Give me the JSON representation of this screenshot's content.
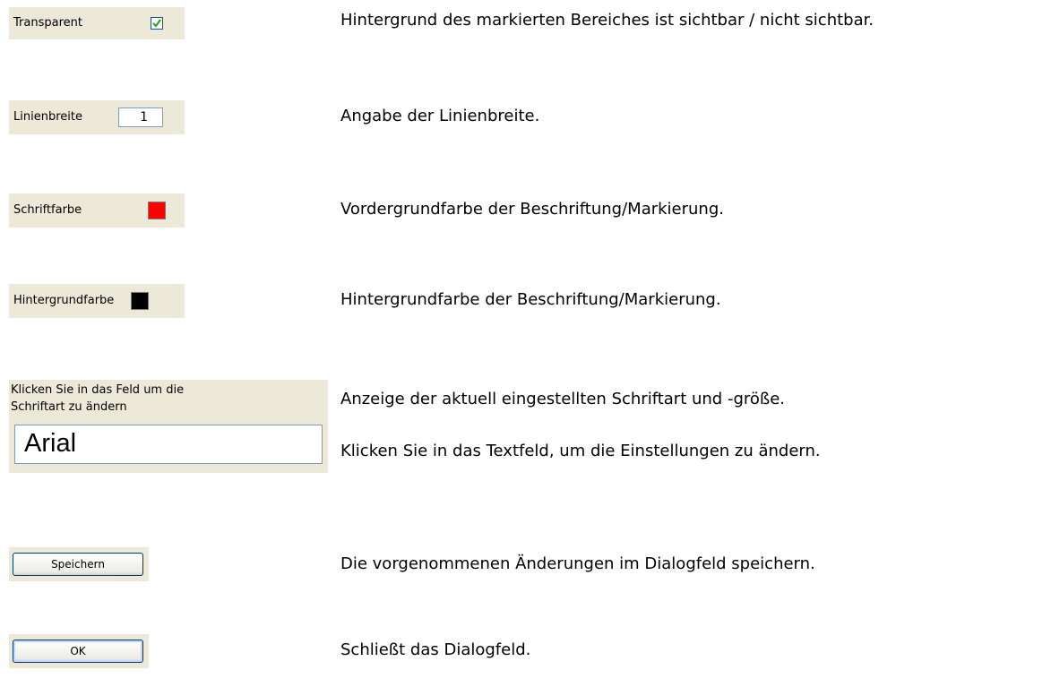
{
  "rows": [
    {
      "label": "Transparent",
      "checked": true,
      "description": "Hintergrund des markierten Bereiches ist sichtbar / nicht sichtbar."
    },
    {
      "label": "Linienbreite",
      "value": "1",
      "description": "Angabe der Linienbreite."
    },
    {
      "label": "Schriftfarbe",
      "color": "#ff0000",
      "description": "Vordergrundfarbe der Beschriftung/Markierung."
    },
    {
      "label": "Hintergrundfarbe",
      "color": "#000000",
      "description": "Hintergrundfarbe der Beschriftung/Markierung."
    },
    {
      "label_line1": "Klicken Sie in das Feld um die",
      "label_line2": "Schriftart zu ändern",
      "value": "Arial",
      "description": "Anzeige der aktuell eingestellten Schriftart und -größe.",
      "description2": "Klicken Sie in das Textfeld, um die Einstellungen zu ändern."
    },
    {
      "button": "Speichern",
      "description": "Die vorgenommenen Änderungen im Dialogfeld speichern."
    },
    {
      "button": "OK",
      "description": "Schließt das Dialogfeld."
    }
  ],
  "icons": {
    "check": "checkmark-icon"
  }
}
